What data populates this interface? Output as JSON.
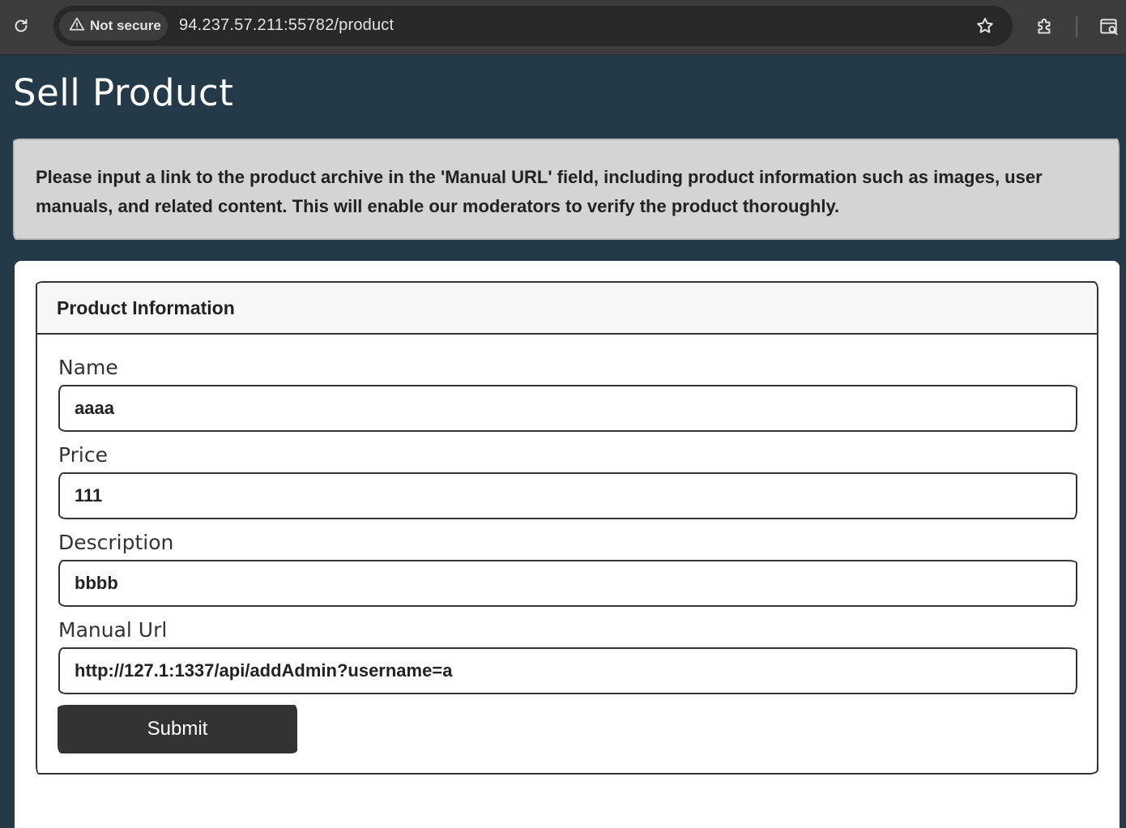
{
  "browser": {
    "security_label": "Not secure",
    "url": "94.237.57.211:55782/product"
  },
  "page": {
    "title": "Sell Product",
    "notice": "Please input a link to the product archive in the 'Manual URL' field, including product information such as images, user manuals, and related content. This will enable our moderators to verify the product thoroughly."
  },
  "form": {
    "header": "Product Information",
    "fields": [
      {
        "label": "Name",
        "value": "aaaa"
      },
      {
        "label": "Price",
        "value": "111"
      },
      {
        "label": "Description",
        "value": "bbbb"
      },
      {
        "label": "Manual Url",
        "value": "http://127.1:1337/api/addAdmin?username=a"
      }
    ],
    "submit_label": "Submit"
  },
  "colors": {
    "page_background": "#243a48",
    "notice_background": "#d4d4d4",
    "button_background": "#333333"
  }
}
